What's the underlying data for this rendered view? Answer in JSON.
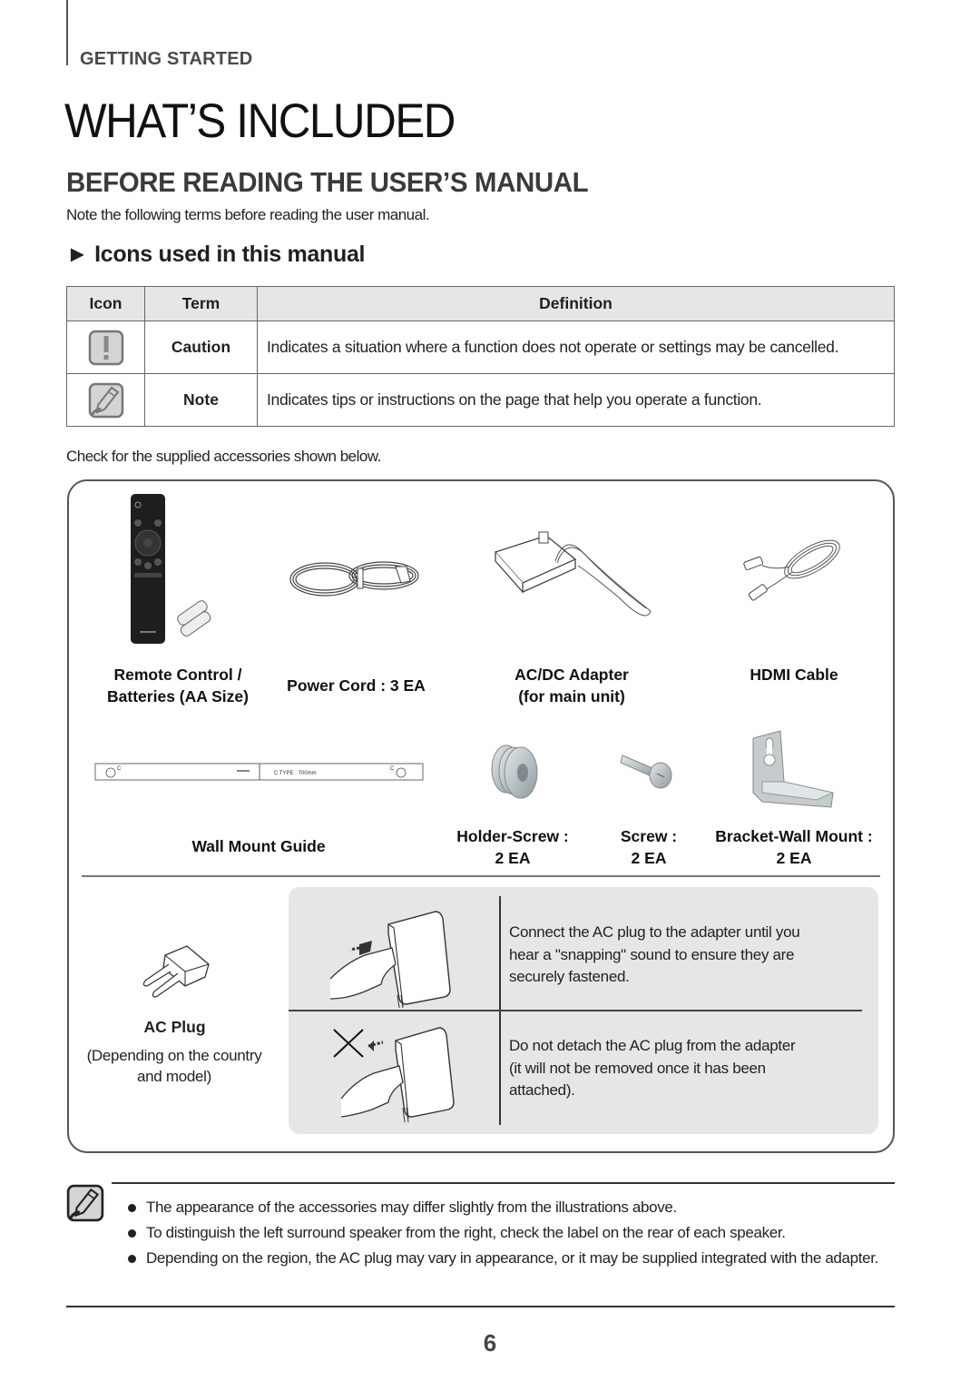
{
  "header": {
    "section": "GETTING STARTED",
    "title": "WHAT’S INCLUDED",
    "subtitle": "BEFORE READING THE USER’S MANUAL",
    "intro": "Note the following terms before reading the user manual.",
    "icons_heading": "► Icons used in this manual"
  },
  "icon_table": {
    "headers": [
      "Icon",
      "Term",
      "Definition"
    ],
    "rows": [
      {
        "icon": "caution-icon",
        "term": "Caution",
        "definition": "Indicates a situation where a function does not operate or settings may be cancelled."
      },
      {
        "icon": "note-icon",
        "term": "Note",
        "definition": "Indicates tips or instructions on the page that help you operate a function."
      }
    ]
  },
  "accessories": {
    "intro": "Check for the supplied accessories shown below.",
    "items": [
      {
        "icon": "remote-control-icon",
        "label_line1": "Remote Control /",
        "label_line2": "Batteries (AA Size)"
      },
      {
        "icon": "power-cord-icon",
        "label_line1": "Power Cord : 3 EA",
        "label_line2": ""
      },
      {
        "icon": "ac-dc-adapter-icon",
        "label_line1": "AC/DC Adapter",
        "label_line2": "(for main unit)"
      },
      {
        "icon": "hdmi-cable-icon",
        "label_line1": "HDMI Cable",
        "label_line2": ""
      },
      {
        "icon": "wall-mount-guide-icon",
        "label_line1": "Wall Mount Guide",
        "label_line2": ""
      },
      {
        "icon": "holder-screw-icon",
        "label_line1": "Holder-Screw :",
        "label_line2": "2 EA"
      },
      {
        "icon": "screw-icon",
        "label_line1": "Screw :",
        "label_line2": "2 EA"
      },
      {
        "icon": "bracket-wall-mount-icon",
        "label_line1": "Bracket-Wall Mount :",
        "label_line2": "2 EA"
      }
    ],
    "wall_guide_text": "C TYPE : 700mm",
    "ac_plug": {
      "icon": "ac-plug-icon",
      "label": "AC Plug",
      "sub_line1": "(Depending on the country",
      "sub_line2": "and model)"
    },
    "instructions": [
      {
        "icon": "connect-plug-illustration",
        "text_lines": [
          "Connect the AC plug to the adapter until you",
          "hear a \"snapping\" sound to ensure they are",
          "securely fastened."
        ]
      },
      {
        "icon": "do-not-detach-illustration",
        "text_lines": [
          "Do not detach the AC plug from the adapter",
          "(it will not be removed once it has been",
          "attached)."
        ]
      }
    ]
  },
  "notes": {
    "icon": "note-icon",
    "items": [
      "The appearance of the accessories may differ slightly from the illustrations above.",
      "To distinguish the left surround speaker from the right, check the label on the rear of each speaker.",
      "Depending on the region, the AC plug may vary in appearance, or it may be supplied integrated with the adapter."
    ]
  },
  "footer": {
    "page_number": "6"
  }
}
